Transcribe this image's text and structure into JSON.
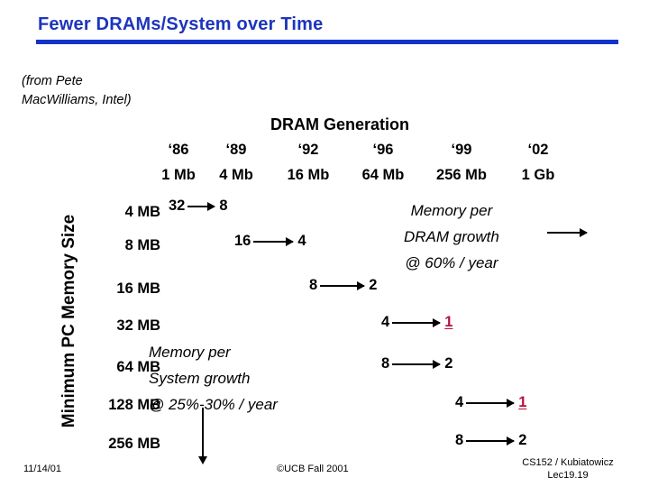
{
  "slide": {
    "title": "Fewer DRAMs/System over Time",
    "title_color": "#1c35bd",
    "attribution": "(from Pete MacWilliams, Intel)",
    "highlight_color": "#b5123f"
  },
  "chart_data": {
    "type": "table",
    "title": "Fewer DRAMs/System over Time",
    "xlabel": "DRAM Generation",
    "ylabel": "Minimum PC Memory Size",
    "column_header_title": "DRAM Generation",
    "years": [
      "‘86",
      "‘89",
      "‘92",
      "‘96",
      "‘99",
      "‘02"
    ],
    "dram_sizes": [
      "1 Mb",
      "4 Mb",
      "16 Mb",
      "64 Mb",
      "256 Mb",
      "1 Gb"
    ],
    "row_labels": [
      "4 MB",
      "8 MB",
      "16 MB",
      "32 MB",
      "64 MB",
      "128 MB",
      "256 MB"
    ],
    "pairs": [
      {
        "row": "4 MB",
        "from": "32",
        "to": "8",
        "highlight": false
      },
      {
        "row": "8 MB",
        "from": "16",
        "to": "4",
        "highlight": false
      },
      {
        "row": "16 MB",
        "from": "8",
        "to": "2",
        "highlight": false
      },
      {
        "row": "32 MB",
        "from": "4",
        "to": "1",
        "highlight": true
      },
      {
        "row": "64 MB",
        "from": "8",
        "to": "2",
        "highlight": false
      },
      {
        "row": "128 MB",
        "from": "4",
        "to": "1",
        "highlight": true
      },
      {
        "row": "256 MB",
        "from": "8",
        "to": "2",
        "highlight": false
      }
    ],
    "annotations": [
      {
        "name": "dram-growth",
        "lines": [
          "Memory per",
          "DRAM growth",
          "@ 60% / year"
        ]
      },
      {
        "name": "system-growth",
        "lines": [
          "Memory per",
          "System growth",
          "@ 25%-30% / year"
        ]
      }
    ]
  },
  "annotations": {
    "dram_growth": {
      "line1": "Memory per",
      "line2": "DRAM growth",
      "line3": "@ 60% / year"
    },
    "system_growth": {
      "line1": "Memory per",
      "line2": "System growth",
      "line3": "@ 25%-30% / year"
    }
  },
  "footer": {
    "date": "11/14/01",
    "center": "©UCB Fall 2001",
    "course": "CS152 / Kubiatowicz",
    "lecture": "Lec19.19"
  }
}
